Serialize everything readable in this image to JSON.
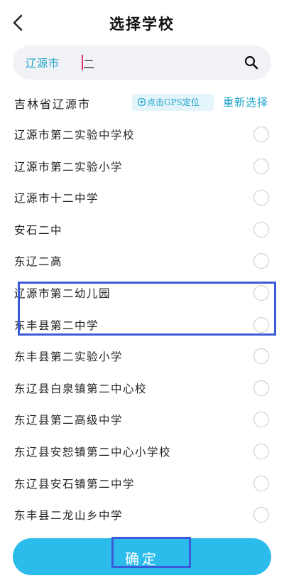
{
  "header": {
    "title": "选择学校"
  },
  "search": {
    "prefix": "辽源市",
    "value": "二"
  },
  "location": {
    "current": "吉林省辽源市",
    "gps_label": "点击GPS定位",
    "reselect_label": "重新选择"
  },
  "schools": [
    {
      "name": "辽源市第二实验中学校"
    },
    {
      "name": "辽源市第二实验小学"
    },
    {
      "name": "辽源市十二中学"
    },
    {
      "name": "安石二中"
    },
    {
      "name": "东辽二高"
    },
    {
      "name": "辽源市第二幼儿园"
    },
    {
      "name": "东丰县第二中学"
    },
    {
      "name": "东丰县第二实验小学"
    },
    {
      "name": "东辽县白泉镇第二中心校"
    },
    {
      "name": "东辽县第二高级中学"
    },
    {
      "name": "东辽县安恕镇第二中心小学校"
    },
    {
      "name": "东辽县安石镇第二中学"
    },
    {
      "name": "东丰县二龙山乡中学"
    }
  ],
  "confirm": {
    "label": "确定"
  },
  "colors": {
    "accent": "#2bbcec",
    "link": "#1aa3c9",
    "highlight": "#3c5bd8",
    "caret": "#e0347a"
  }
}
